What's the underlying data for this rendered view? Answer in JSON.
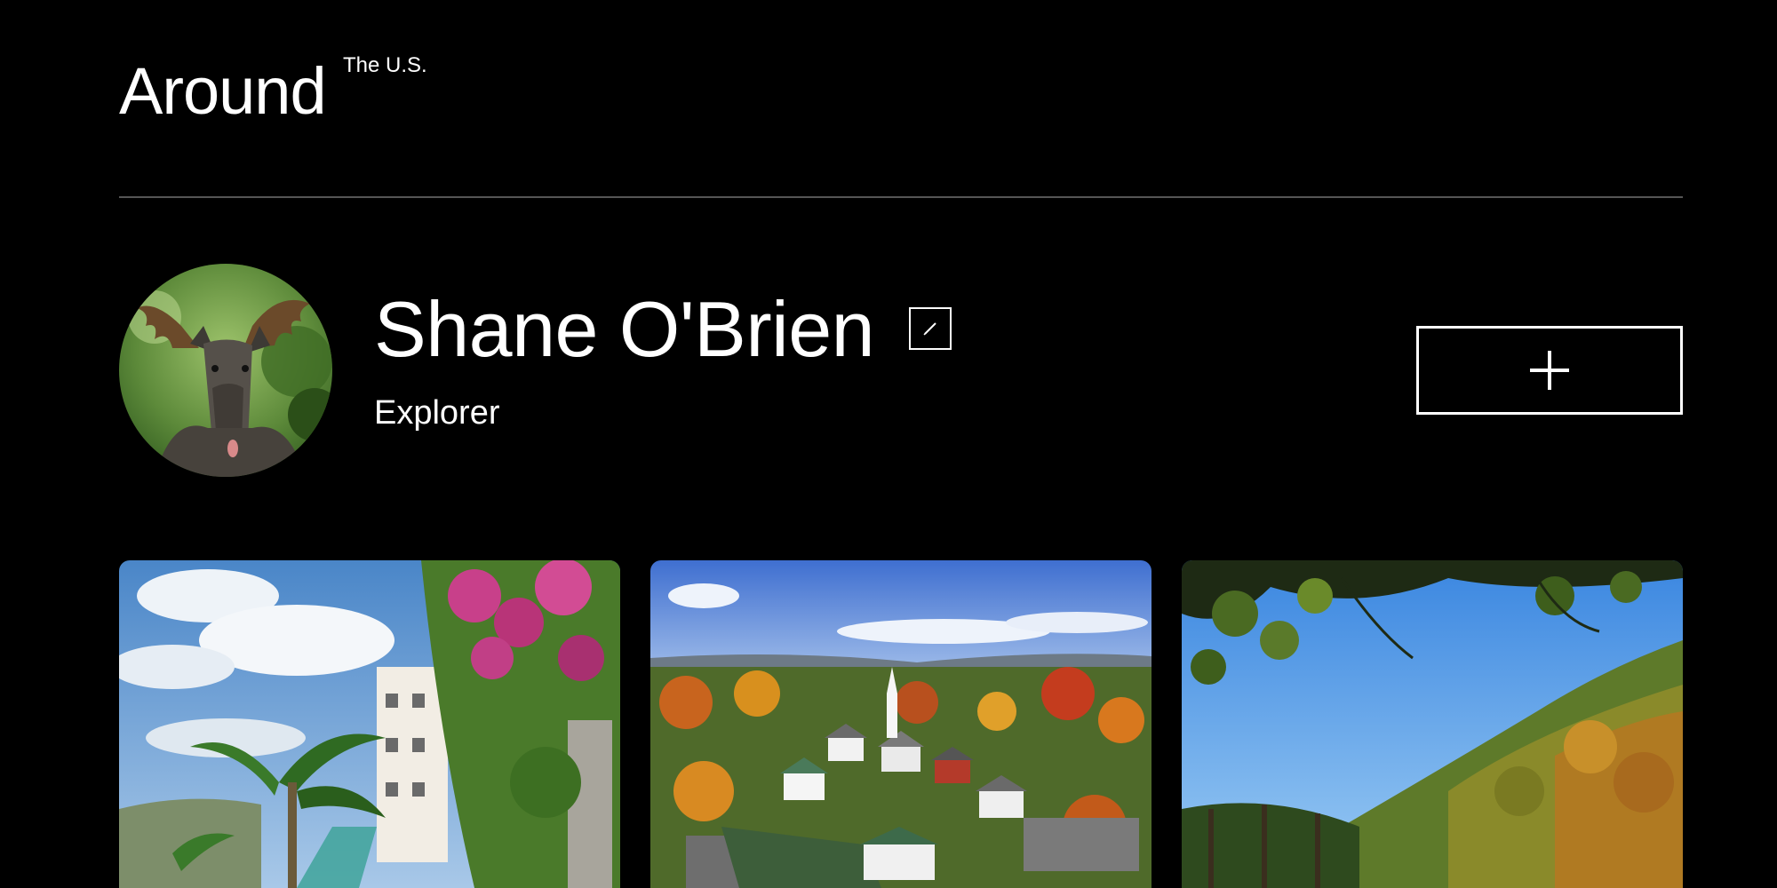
{
  "header": {
    "logo_main": "Around",
    "logo_sup": "The U.S."
  },
  "profile": {
    "name": "Shane O'Brien",
    "role": "Explorer",
    "avatar_icon": "moose-avatar"
  },
  "actions": {
    "edit_icon": "pencil-icon",
    "add_icon": "plus-icon"
  },
  "cards": [
    {
      "image": "tropical-villa-with-flowers"
    },
    {
      "image": "autumn-town-aerial"
    },
    {
      "image": "autumn-mountain-valley"
    }
  ],
  "colors": {
    "background": "#000000",
    "text": "#ffffff",
    "divider": "#555555"
  }
}
